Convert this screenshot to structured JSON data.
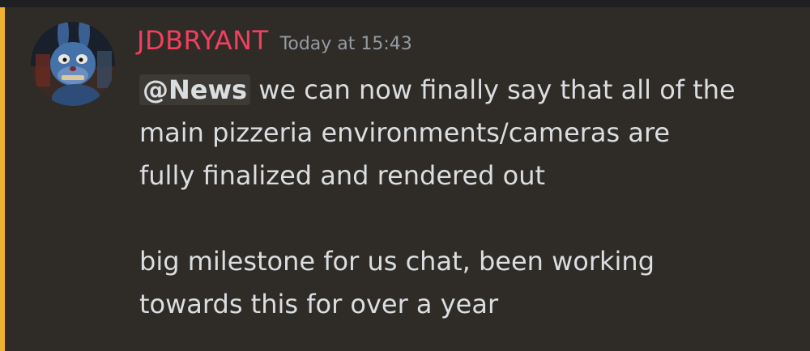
{
  "message": {
    "author": "JDBRYANT",
    "timestamp": "Today at 15:43",
    "mention": "@News",
    "line_1_rest": " we can now finally say that all of the",
    "line_2": "main pizzeria environments/cameras are",
    "line_3": "fully finalized and rendered out",
    "line_4": "big milestone for us chat, been working",
    "line_5": "towards this for over a year"
  },
  "colors": {
    "author": "#f23f5d",
    "timestamp": "#949ba4",
    "text": "#dbdee1",
    "mention_bar": "#f0b132",
    "background": "#2f2c28"
  },
  "icons": {
    "avatar": "animatronic-bunny-avatar"
  }
}
